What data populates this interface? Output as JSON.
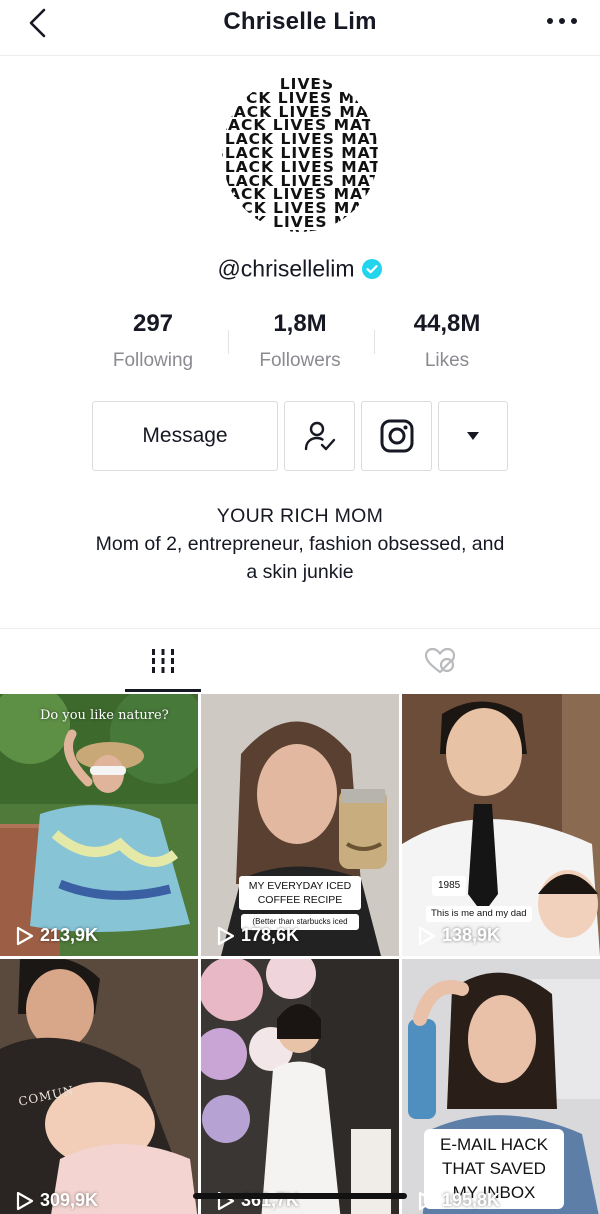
{
  "header": {
    "title": "Chriselle Lim",
    "back_icon": "chevron-left-icon",
    "more_icon": "more-horizontal-icon"
  },
  "profile": {
    "avatar_text_lines": [
      "LIVES",
      "CK LIVES MA",
      "LACK LIVES MATT",
      "LACK LIVES MATTE",
      "BLACK LIVES MATTE",
      "BLACK LIVES MATTER",
      "BLACK LIVES MATTER",
      "BLACK LIVES MATTE",
      "LACK LIVES MATTE",
      "ACK LIVES MATT",
      "ACK LIVES MATT",
      "CK LIVES MA",
      "LIVES M"
    ],
    "handle": "@chrisellelim",
    "verified_color": "#20d5ec"
  },
  "stats": [
    {
      "value": "297",
      "label": "Following"
    },
    {
      "value": "1,8M",
      "label": "Followers"
    },
    {
      "value": "44,8M",
      "label": "Likes"
    }
  ],
  "actions": {
    "message_label": "Message",
    "following_icon": "user-check-icon",
    "instagram_icon": "instagram-icon",
    "dropdown_icon": "caret-down-icon"
  },
  "bio": {
    "title": "YOUR RICH MOM",
    "line1": "Mom of 2, entrepreneur, fashion obsessed, and",
    "line2": "a skin junkie"
  },
  "tabs": [
    {
      "name": "videos",
      "icon": "grid-icon",
      "active": true
    },
    {
      "name": "liked",
      "icon": "liked-private-icon",
      "active": false
    }
  ],
  "videos": [
    {
      "views": "213,9K",
      "caption": "Do you like nature?"
    },
    {
      "views": "178,6K",
      "caption": "MY EVERYDAY ICED COFFEE RECIPE",
      "subcaption": "(Better than starbucks iced"
    },
    {
      "views": "138,9K",
      "caption": "1985",
      "subcaption": "This is me and my dad"
    },
    {
      "views": "309,9K",
      "caption": "COMUN"
    },
    {
      "views": "361,7K",
      "caption": ""
    },
    {
      "views": "195,8K",
      "caption": "E-MAIL HACK THAT SAVED MY INBOX"
    }
  ]
}
